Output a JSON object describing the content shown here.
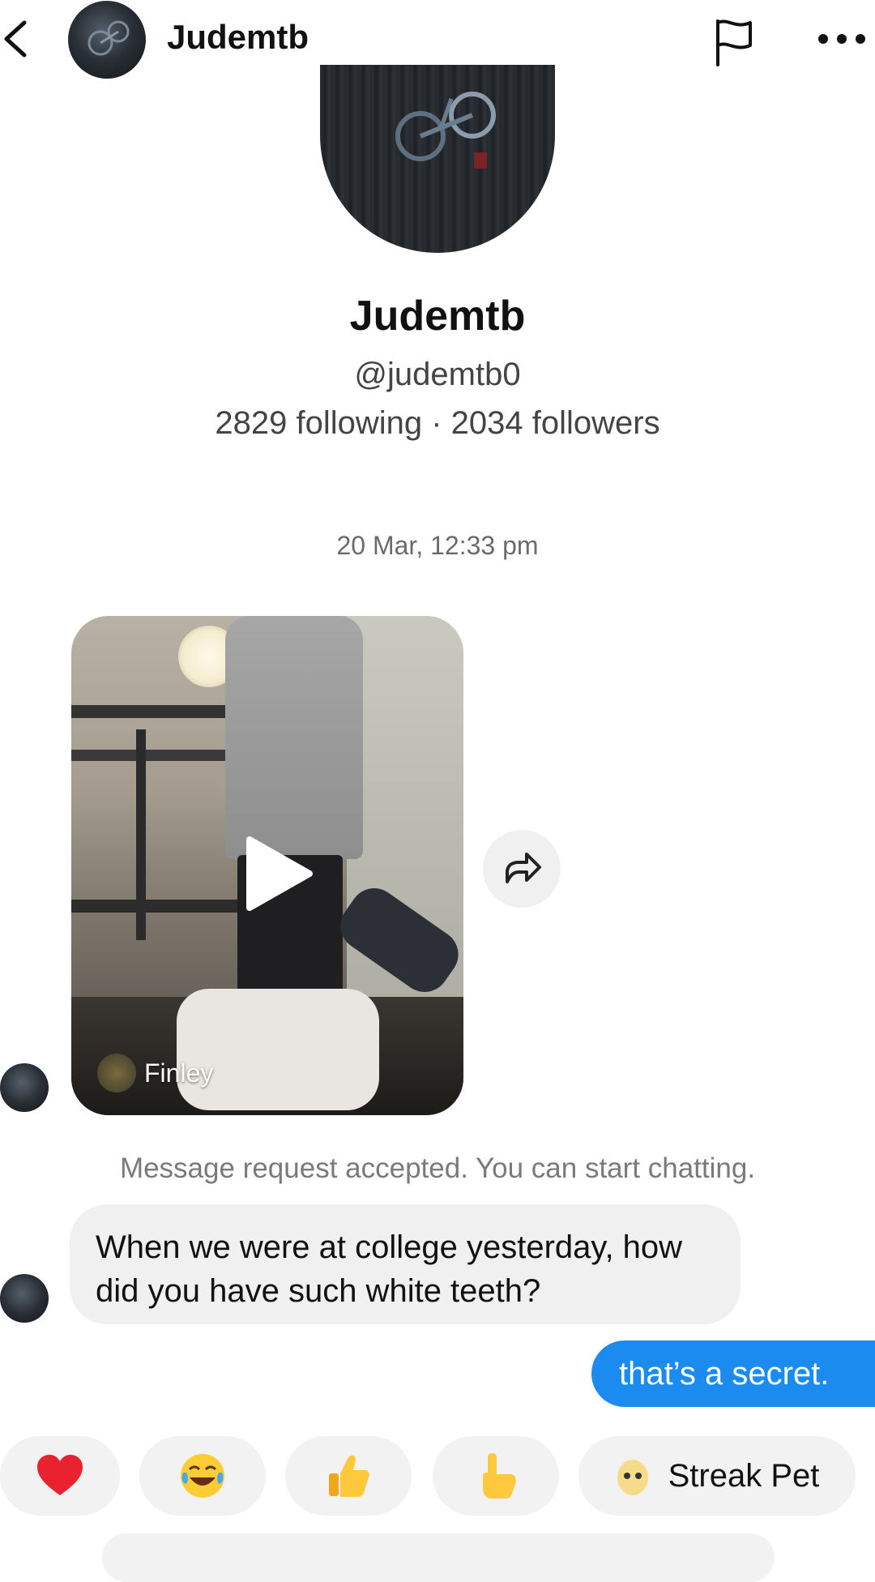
{
  "header": {
    "back_icon": "chevron-left-icon",
    "username": "Judemtb",
    "report_icon": "flag-icon",
    "more_icon": "more-horizontal-icon"
  },
  "profile": {
    "display_name": "Judemtb",
    "handle": "@judemtb0",
    "stats": "2829 following · 2034 followers"
  },
  "conversation": {
    "timestamp": "20 Mar, 12:33 pm",
    "shared_video": {
      "creator": "Finley",
      "play_icon": "play-icon",
      "share_icon": "share-icon"
    },
    "notice": "Message request accepted. You can start chatting.",
    "messages": [
      {
        "from": "them",
        "text": "When we were at college yesterday, how did you have such white teeth?"
      },
      {
        "from": "me",
        "text": "that’s a secret."
      }
    ]
  },
  "quick_reactions": [
    {
      "icon": "red-heart-icon",
      "glyph": "❤️"
    },
    {
      "icon": "tears-of-joy-icon",
      "glyph": "😂"
    },
    {
      "icon": "thumbs-up-icon",
      "glyph": "👍"
    },
    {
      "icon": "pointing-hand-icon",
      "glyph": "👆"
    },
    {
      "icon": "streak-pet-icon",
      "label": "Streak Pet"
    }
  ],
  "colors": {
    "outgoing_bubble": "#1b8bf0",
    "incoming_bubble": "#f0f0f0"
  }
}
